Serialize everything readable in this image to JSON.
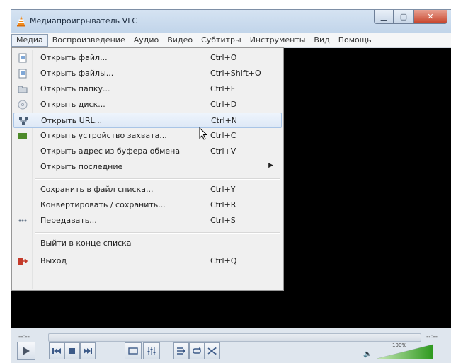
{
  "window": {
    "title": "Медиапроигрыватель VLC",
    "controls": [
      "minimize",
      "maximize",
      "close"
    ],
    "icon": "vlc-cone-icon"
  },
  "menubar": {
    "items": [
      "Медиа",
      "Воспроизведение",
      "Аудио",
      "Видео",
      "Субтитры",
      "Инструменты",
      "Вид",
      "Помощь"
    ],
    "active": "Медиа"
  },
  "media_menu": {
    "items": [
      {
        "label": "Открыть файл...",
        "shortcut": "Ctrl+O",
        "icon": "open-file-icon"
      },
      {
        "label": "Открыть файлы...",
        "shortcut": "Ctrl+Shift+O",
        "icon": "open-files-icon"
      },
      {
        "label": "Открыть папку...",
        "shortcut": "Ctrl+F",
        "icon": "folder-icon"
      },
      {
        "label": "Открыть диск...",
        "shortcut": "Ctrl+D",
        "icon": "disc-icon"
      },
      {
        "label": "Открыть URL...",
        "shortcut": "Ctrl+N",
        "icon": "network-icon",
        "hovered": true
      },
      {
        "label": "Открыть устройство захвата...",
        "shortcut": "Ctrl+C",
        "icon": "capture-device-icon"
      },
      {
        "label": "Открыть адрес из буфера обмена",
        "shortcut": "Ctrl+V"
      },
      {
        "label": "Открыть последние",
        "has_submenu": true
      },
      {
        "label": "Сохранить в файл списка...",
        "shortcut": "Ctrl+Y"
      },
      {
        "label": "Конвертировать / сохранить...",
        "shortcut": "Ctrl+R"
      },
      {
        "label": "Передавать...",
        "shortcut": "Ctrl+S",
        "icon": "stream-icon"
      },
      {
        "label": "Выйти в конце списка"
      },
      {
        "label": "Выход",
        "shortcut": "Ctrl+Q",
        "icon": "quit-icon"
      }
    ]
  },
  "controls": {
    "elapsed": "--:--",
    "remaining": "--:--",
    "volume_text": "100%",
    "volume_level": 1.0
  },
  "colors": {
    "accent": "#3a9a2a",
    "video_bg": "#000000",
    "menu_bg": "#f0f0f0",
    "hover_border": "#a8c4e6"
  }
}
